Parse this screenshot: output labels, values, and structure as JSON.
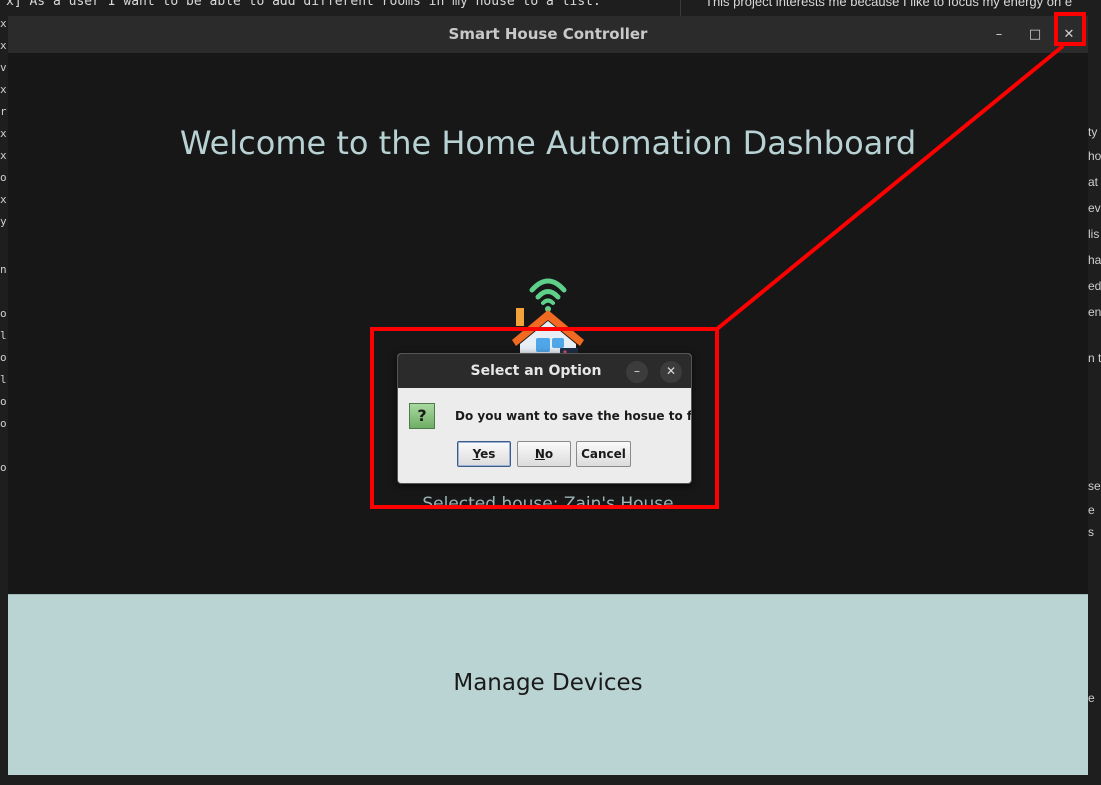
{
  "background": {
    "left_editor_line": "x] As a user I want to be able to add different rooms in my house to a list.",
    "right_doc_line": "This project interests me because I like to focus my energy on e",
    "left_gutter_chars": [
      "x",
      "x",
      "v",
      "x",
      "r",
      "x",
      "x",
      "o",
      "x",
      "y",
      "n",
      "o",
      "l",
      "o",
      "l",
      "o",
      "o",
      "o"
    ],
    "right_edge_texts": [
      "ty",
      "ho",
      "at",
      "evi",
      "lis",
      "ha",
      "ed",
      "en",
      "n t",
      "se",
      "e",
      "s",
      "e"
    ]
  },
  "window": {
    "title": "Smart House Controller",
    "controls": {
      "minimize": "–",
      "maximize": "□",
      "close": "✕"
    }
  },
  "main": {
    "heading": "Welcome to the Home Automation Dashboard",
    "house_icon": "smart-home-icon",
    "selected_house": "Selected house: Zain's House",
    "manage_devices_label": "Manage Devices",
    "manage_devices_bg": "#bad4d4"
  },
  "dialog": {
    "title": "Select an Option",
    "controls": {
      "minimize": "–",
      "close": "✕"
    },
    "icon": "question-icon",
    "icon_glyph": "?",
    "message": "Do you want to save the hosue to file?",
    "buttons": {
      "yes": {
        "mnemonic": "Y",
        "rest": "es"
      },
      "no": {
        "mnemonic": "N",
        "rest": "o"
      },
      "cancel": "Cancel"
    }
  },
  "annotation": {
    "color": "#ff0000"
  }
}
